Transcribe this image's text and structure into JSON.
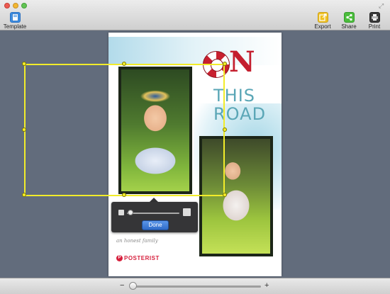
{
  "toolbar": {
    "template_label": "Template",
    "export_label": "Export",
    "share_label": "Share",
    "print_label": "Print"
  },
  "poster": {
    "title_letter": "N",
    "title_line2": "THIS",
    "title_line3": "ROAD",
    "tagline": "an honest family",
    "brand": "POSTERIST",
    "brand_icon": "P"
  },
  "popover": {
    "done_label": "Done",
    "photo_size_level": 0
  },
  "zoom": {
    "minus_label": "−",
    "plus_label": "+",
    "level": 0
  },
  "icons": {
    "template": "template-icon",
    "export": "export-icon",
    "share": "share-icon",
    "print": "printer-icon"
  },
  "colors": {
    "selection": "#f2ec2a",
    "title_red": "#c41e2e",
    "title_teal": "#5aa6b6",
    "done_blue": "#2f6cc9"
  }
}
